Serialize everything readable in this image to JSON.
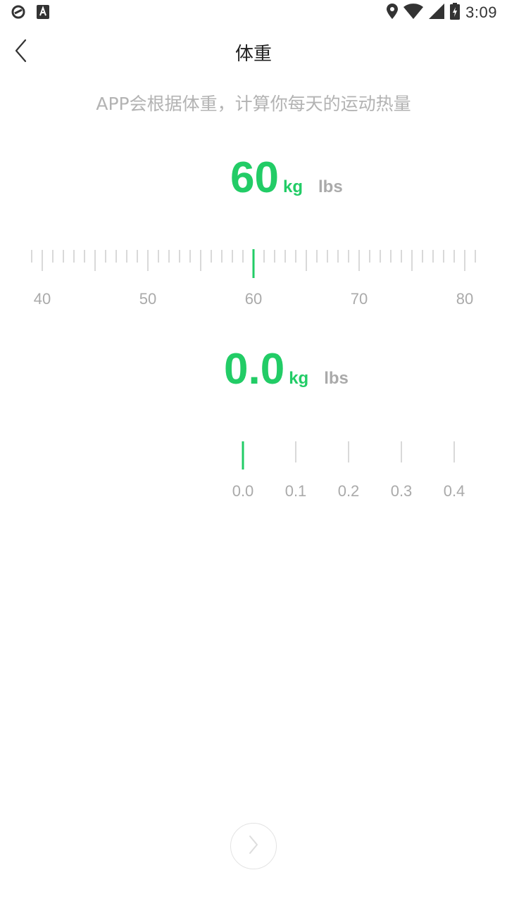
{
  "status_bar": {
    "time": "3:09",
    "icons": [
      "sync-icon",
      "a-notification-icon",
      "location-icon",
      "wifi-icon",
      "signal-icon",
      "battery-charging-icon"
    ]
  },
  "nav": {
    "title": "体重",
    "back_icon": "chevron-left-icon"
  },
  "subtitle": "APP会根据体重，计算你每天的运动热量",
  "main_weight": {
    "value": "60",
    "unit_selected": "kg",
    "unit_alt": "lbs",
    "ruler": {
      "min": 40,
      "max": 80,
      "selected": 60,
      "labels": [
        "40",
        "50",
        "60",
        "70",
        "80"
      ]
    }
  },
  "decimal_weight": {
    "value": "0.0",
    "unit_selected": "kg",
    "unit_alt": "lbs",
    "ruler": {
      "selected": 0.0,
      "labels": [
        "0.0",
        "0.1",
        "0.2",
        "0.3",
        "0.4"
      ]
    }
  },
  "colors": {
    "accent": "#22cc66",
    "tick": "#cccccc",
    "label": "#aaaaaa"
  },
  "next_button": {
    "icon": "chevron-right-icon"
  }
}
